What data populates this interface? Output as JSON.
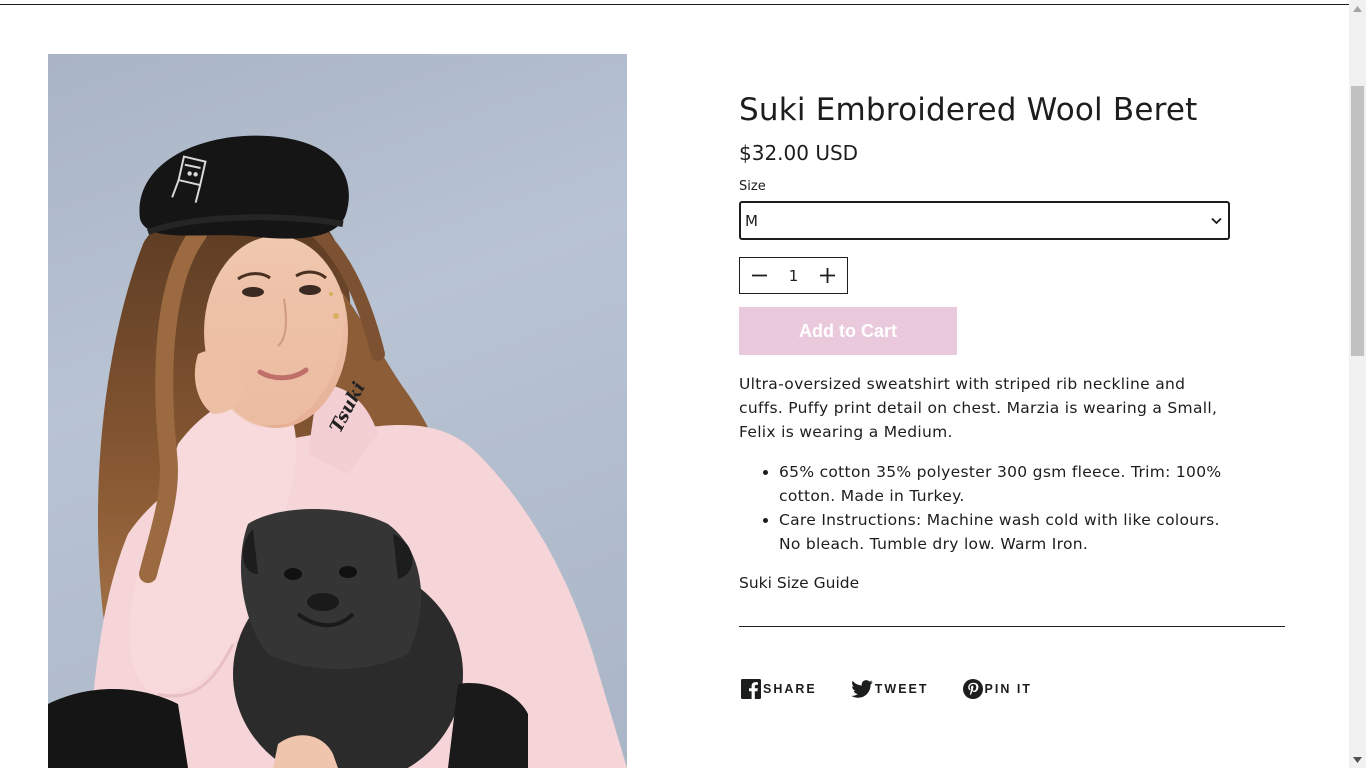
{
  "product": {
    "title": "Suki Embroidered Wool Beret",
    "price": "$32.00 USD",
    "size_label": "Size",
    "size_selected": "M",
    "quantity": "1",
    "add_to_cart_label": "Add to Cart",
    "description": "Ultra-oversized sweatshirt with striped rib neckline and cuffs. Puffy print detail on chest. Marzia is wearing a Small, Felix is wearing a Medium.",
    "details": [
      "65% cotton 35% polyester 300 gsm fleece. Trim: 100% cotton. Made in Turkey.",
      "Care Instructions: Machine wash cold with like colours. No bleach. Tumble dry low. Warm Iron."
    ],
    "size_guide_label": "Suki Size Guide",
    "photo_neck_text": "Tsuki"
  },
  "share": {
    "facebook_label": "SHARE",
    "twitter_label": "TWEET",
    "pinterest_label": "PIN IT"
  },
  "colors": {
    "add_to_cart_bg": "#ebc9dc",
    "text": "#1c1d1d"
  },
  "icons": {
    "minus": "minus-icon",
    "plus": "plus-icon",
    "select": "chevron-down-icon",
    "facebook": "facebook-icon",
    "twitter": "twitter-icon",
    "pinterest": "pinterest-icon"
  }
}
